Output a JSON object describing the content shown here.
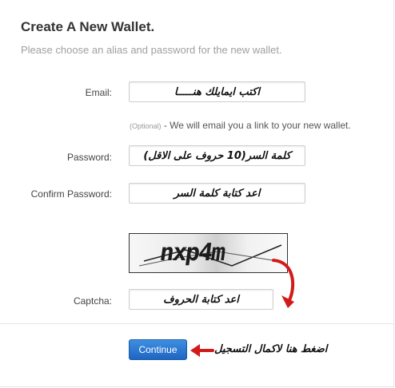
{
  "header": {
    "title": "Create A New Wallet.",
    "subtitle": "Please choose an alias and password for the new wallet."
  },
  "form": {
    "email": {
      "label": "Email:",
      "value": "اكتب ايمايلك هنـــــا"
    },
    "hint": {
      "optional": "(Optional)",
      "text": " - We will email you a link to your new wallet."
    },
    "password": {
      "label": "Password:",
      "value": "كلمة السر(10 حروف على الاقل)"
    },
    "confirm_password": {
      "label": "Confirm Password:",
      "value": "اعد كتابة كلمة السر"
    },
    "captcha": {
      "image_text": "nxp4m",
      "label": "Captcha:",
      "value": "اعد كتابة الحروف"
    }
  },
  "actions": {
    "continue_label": "Continue",
    "continue_annotation": "اضغط هنا لاكمال التسجيل"
  },
  "colors": {
    "button": "#1f65c3",
    "arrow": "#d21a1a"
  }
}
